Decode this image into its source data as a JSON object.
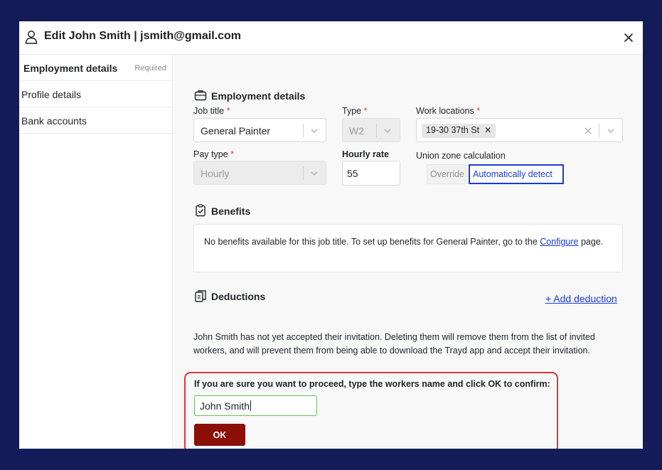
{
  "header": {
    "title": "Edit John Smith | jsmith@gmail.com",
    "person_icon": "person-icon",
    "close_icon": "close-icon"
  },
  "sidebar": {
    "items": [
      {
        "label": "Employment details",
        "badge": "Required",
        "active": true
      },
      {
        "label": "Profile details"
      },
      {
        "label": "Bank accounts"
      }
    ]
  },
  "employment": {
    "title": "Employment details",
    "icon": "briefcase-icon",
    "job_title_label": "Job title",
    "job_title_value": "General Painter",
    "type_label": "Type",
    "type_value": "W2",
    "work_locations_label": "Work locations",
    "work_location_tag": "19-30 37th St",
    "pay_type_label": "Pay type",
    "pay_type_value": "Hourly",
    "hourly_rate_label": "Hourly rate",
    "hourly_rate_value": "55",
    "union_zone_label": "Union zone calculation",
    "override_label": "Override",
    "auto_detect_label": "Automatically detect",
    "required_star": "*"
  },
  "benefits": {
    "title": "Benefits",
    "icon": "clipboard-check-icon",
    "text_before": "No benefits available for this job title. To set up benefits for General Painter, go to the ",
    "link": "Configure",
    "text_after": " page."
  },
  "deductions": {
    "title": "Deductions",
    "icon": "documents-icon",
    "add_label": "+ Add deduction"
  },
  "warning": {
    "text": "John Smith has not yet accepted their invitation. Deleting them will remove them from the list of invited workers, and will prevent them from being able to download the Trayd app and accept their invitation."
  },
  "confirm": {
    "label": "If you are sure you want to proceed, type the workers name and click OK to confirm:",
    "input_value": "John Smith",
    "ok_label": "OK"
  },
  "colors": {
    "backdrop": "#131c58",
    "accent": "#1b3bd4",
    "danger_border": "#e03434",
    "ok_button": "#8b0f05",
    "input_focus": "#6bbf59"
  }
}
